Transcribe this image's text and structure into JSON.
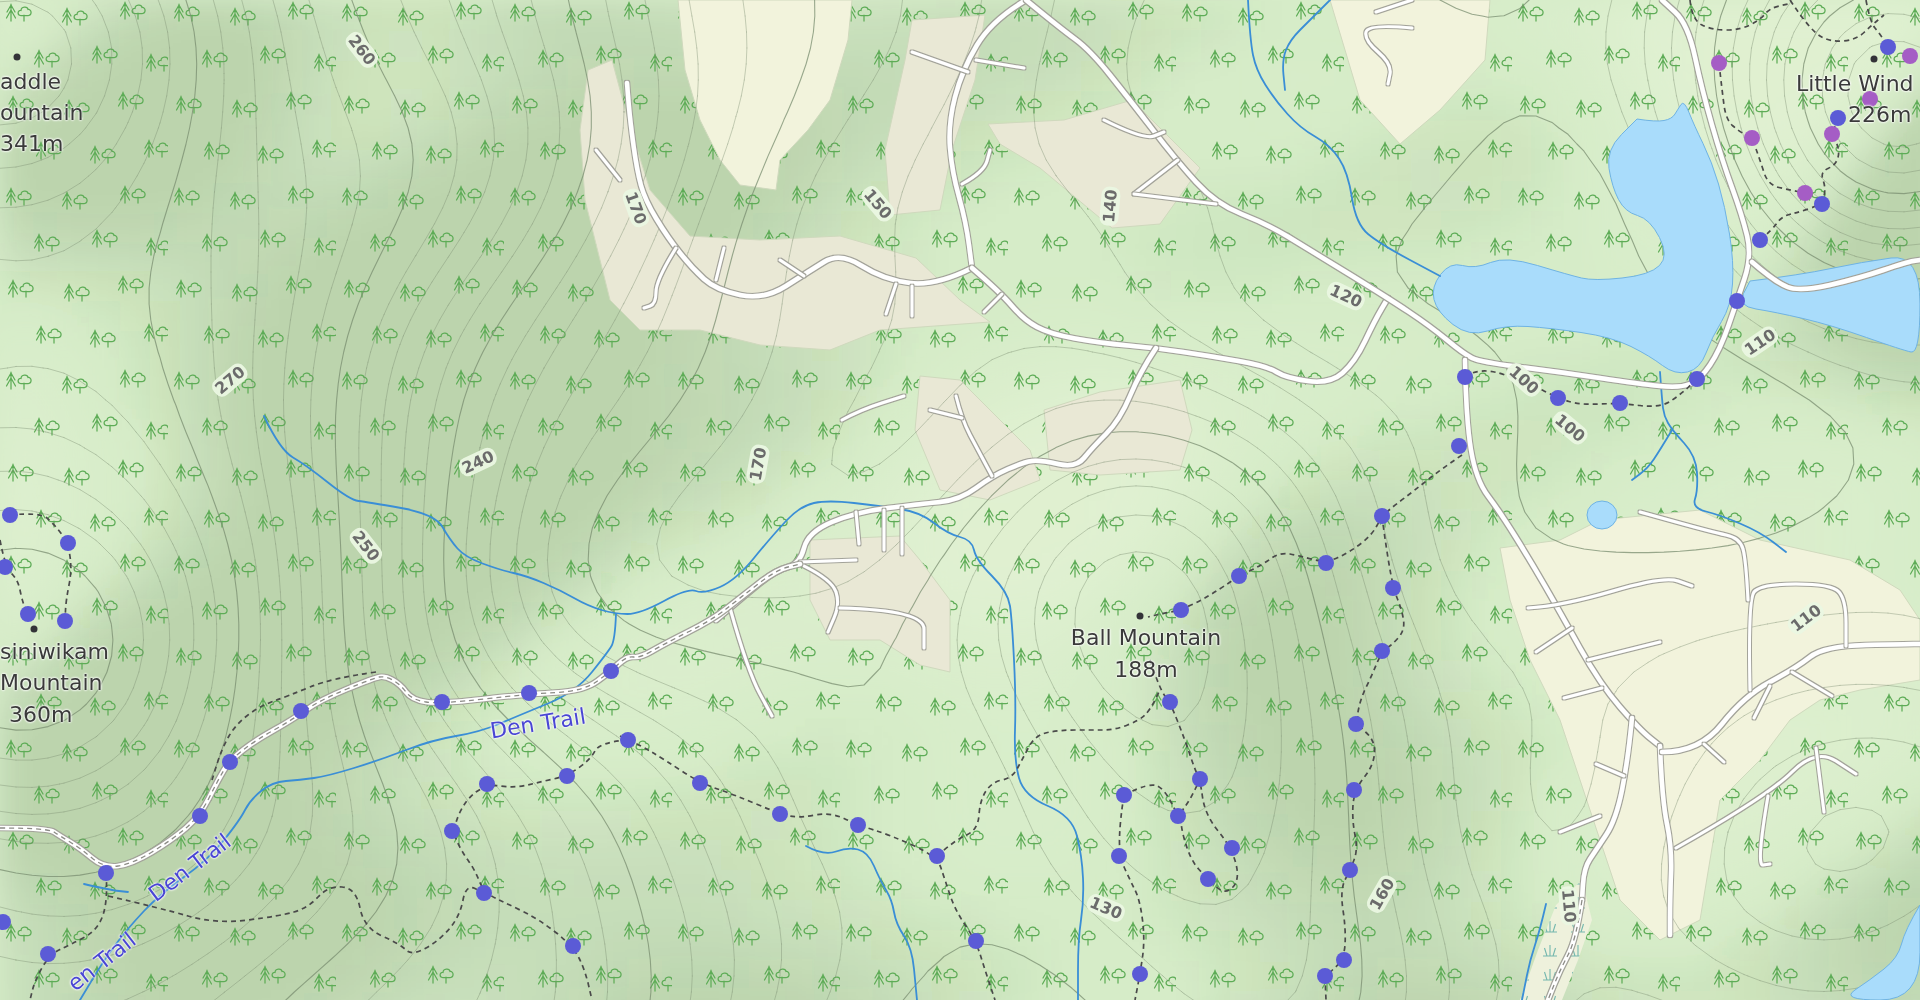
{
  "peaks": [
    {
      "name_lines": [
        "addle",
        "ountain"
      ],
      "elevation": "341m"
    },
    {
      "name_lines": [
        "siniwikam",
        "Mountain"
      ],
      "elevation": "360m"
    },
    {
      "name_lines": [
        "Ball Mountain"
      ],
      "elevation": "188m"
    },
    {
      "name_lines": [
        "Little Wind"
      ],
      "elevation": "226m"
    }
  ],
  "contour_labels": [
    "260",
    "270",
    "240",
    "250",
    "170",
    "150",
    "140",
    "120",
    "170",
    "100",
    "100",
    "110",
    "110",
    "130",
    "160",
    "110"
  ],
  "trail_labels": [
    "Den Trail",
    "Den Trail",
    "en Trail"
  ],
  "markers": [
    {
      "color": "#5b5bd6"
    },
    {
      "color": "#5b5bd6"
    },
    {
      "color": "#5b5bd6"
    },
    {
      "color": "#5b5bd6"
    },
    {
      "color": "#5b5bd6"
    },
    {
      "color": "#5b5bd6"
    },
    {
      "color": "#5b5bd6"
    },
    {
      "color": "#5b5bd6"
    },
    {
      "color": "#5b5bd6"
    },
    {
      "color": "#5b5bd6"
    },
    {
      "color": "#5b5bd6"
    },
    {
      "color": "#5b5bd6"
    },
    {
      "color": "#5b5bd6"
    },
    {
      "color": "#5b5bd6"
    },
    {
      "color": "#5b5bd6"
    },
    {
      "color": "#5b5bd6"
    },
    {
      "color": "#5b5bd6"
    },
    {
      "color": "#5b5bd6"
    },
    {
      "color": "#5b5bd6"
    },
    {
      "color": "#5b5bd6"
    },
    {
      "color": "#5b5bd6"
    },
    {
      "color": "#5b5bd6"
    },
    {
      "color": "#5b5bd6"
    },
    {
      "color": "#5b5bd6"
    },
    {
      "color": "#5b5bd6"
    },
    {
      "color": "#5b5bd6"
    },
    {
      "color": "#5b5bd6"
    },
    {
      "color": "#5b5bd6"
    },
    {
      "color": "#5b5bd6"
    },
    {
      "color": "#5b5bd6"
    },
    {
      "color": "#5b5bd6"
    },
    {
      "color": "#5b5bd6"
    },
    {
      "color": "#5b5bd6"
    },
    {
      "color": "#5b5bd6"
    },
    {
      "color": "#5b5bd6"
    },
    {
      "color": "#5b5bd6"
    },
    {
      "color": "#5b5bd6"
    },
    {
      "color": "#5b5bd6"
    },
    {
      "color": "#5b5bd6"
    },
    {
      "color": "#5b5bd6"
    },
    {
      "color": "#5b5bd6"
    },
    {
      "color": "#5b5bd6"
    },
    {
      "color": "#5b5bd6"
    },
    {
      "color": "#5b5bd6"
    },
    {
      "color": "#5b5bd6"
    },
    {
      "color": "#5b5bd6"
    },
    {
      "color": "#5b5bd6"
    },
    {
      "color": "#5b5bd6"
    },
    {
      "color": "#5b5bd6"
    },
    {
      "color": "#5b5bd6"
    },
    {
      "color": "#5b5bd6"
    },
    {
      "color": "#5b5bd6"
    },
    {
      "color": "#5b5bd6"
    },
    {
      "color": "#5b5bd6"
    },
    {
      "color": "#a55dc5"
    },
    {
      "color": "#a55dc5"
    },
    {
      "color": "#a55dc5"
    },
    {
      "color": "#a55dc5"
    },
    {
      "color": "#a55dc5"
    },
    {
      "color": "#a55dc5"
    }
  ]
}
